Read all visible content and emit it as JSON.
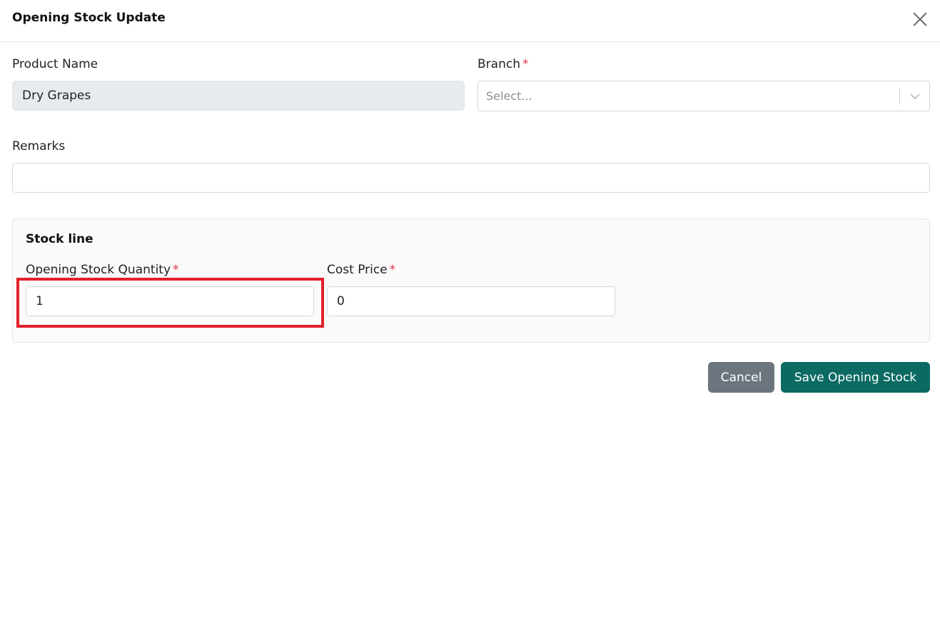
{
  "dialog": {
    "title": "Opening Stock Update",
    "close_icon": "close-icon"
  },
  "form": {
    "product_name": {
      "label": "Product Name",
      "value": "Dry Grapes",
      "readonly": true
    },
    "branch": {
      "label": "Branch",
      "required_mark": "*",
      "placeholder": "Select...",
      "icon": "chevron-down-icon"
    },
    "remarks": {
      "label": "Remarks",
      "value": ""
    }
  },
  "stock_line": {
    "title": "Stock line",
    "opening_quantity": {
      "label": "Opening Stock Quantity",
      "required_mark": "*",
      "value": "1",
      "highlighted": true
    },
    "cost_price": {
      "label": "Cost Price",
      "required_mark": "*",
      "value": "0"
    }
  },
  "actions": {
    "cancel_label": "Cancel",
    "save_label": "Save Opening Stock"
  },
  "colors": {
    "required": "#dc3545",
    "save_button": "#0b6b63",
    "cancel_button": "#6c757d",
    "highlight": "#e3202a",
    "readonly_bg": "#e8ebee"
  }
}
